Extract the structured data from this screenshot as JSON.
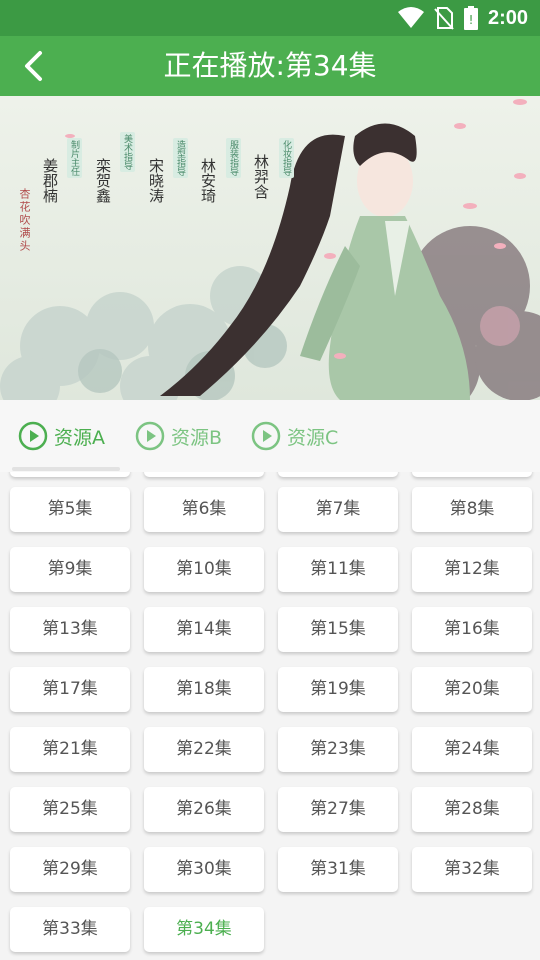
{
  "status_bar": {
    "time": "2:00",
    "icons": [
      "wifi-icon",
      "no-sim-icon",
      "battery-icon"
    ]
  },
  "header": {
    "title": "正在播放:第34集",
    "back_icon": "chevron-left-icon",
    "color": "#4caf50"
  },
  "video": {
    "credits": [
      {
        "role": "化妆指导",
        "name": "林羿含"
      },
      {
        "role": "服装指导",
        "name": "林安琦"
      },
      {
        "role": "造型指导",
        "name": "宋晓涛"
      },
      {
        "role": "美术指导",
        "name": "栾贺鑫"
      },
      {
        "role": "制片主任",
        "name": "姜郡楠"
      }
    ],
    "poem": "杏花吹满头"
  },
  "sources": [
    {
      "label": "资源A",
      "active": true
    },
    {
      "label": "资源B",
      "active": false
    },
    {
      "label": "资源C",
      "active": false
    }
  ],
  "episodes": [
    "第5集",
    "第6集",
    "第7集",
    "第8集",
    "第9集",
    "第10集",
    "第11集",
    "第12集",
    "第13集",
    "第14集",
    "第15集",
    "第16集",
    "第17集",
    "第18集",
    "第19集",
    "第20集",
    "第21集",
    "第22集",
    "第23集",
    "第24集",
    "第25集",
    "第26集",
    "第27集",
    "第28集",
    "第29集",
    "第30集",
    "第31集",
    "第32集",
    "第33集",
    "第34集"
  ],
  "current_episode": "第34集"
}
